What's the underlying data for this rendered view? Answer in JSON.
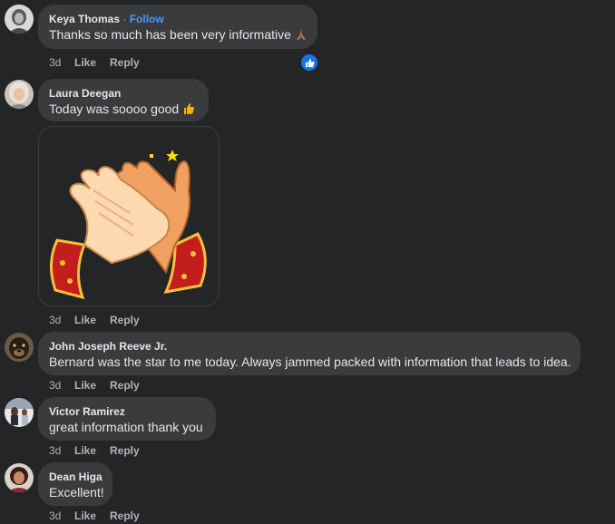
{
  "comments": [
    {
      "author": "Keya Thomas",
      "separator": "·",
      "follow_label": "Follow",
      "text": "Thanks so much has been very informative",
      "emoji_icon": "folded-hands-emoji",
      "time": "3d",
      "like_label": "Like",
      "reply_label": "Reply",
      "reaction_icon": "thumbs-up-reaction-icon"
    },
    {
      "author": "Laura Deegan",
      "text": "Today was soooo good",
      "emoji_icon": "thumbs-up-emoji",
      "gif": "clapping-hands-gif",
      "time": "3d",
      "like_label": "Like",
      "reply_label": "Reply"
    },
    {
      "author": "John Joseph Reeve Jr.",
      "text": "Bernard was the star to me today. Always jammed packed with information that leads to idea.",
      "time": "3d",
      "like_label": "Like",
      "reply_label": "Reply"
    },
    {
      "author": "Victor Ramirez",
      "text": "great information thank you",
      "time": "3d",
      "like_label": "Like",
      "reply_label": "Reply"
    },
    {
      "author": "Dean Higa",
      "text": "Excellent!",
      "time": "3d",
      "like_label": "Like",
      "reply_label": "Reply"
    }
  ],
  "colors": {
    "background": "#242526",
    "bubble": "#3a3b3c",
    "follow": "#4599ff",
    "secondary_text": "#b0b3b8",
    "reaction_blue": "#1b74e4"
  }
}
